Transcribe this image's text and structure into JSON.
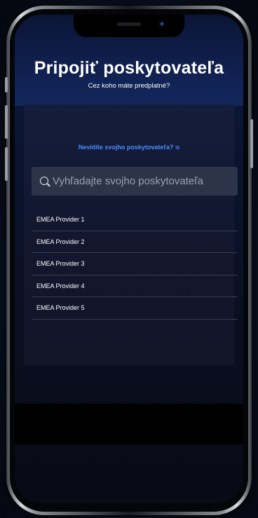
{
  "header": {
    "title": "Pripojiť poskytovateľa",
    "subtitle": "Cez koho máte predplatné?"
  },
  "help_link": {
    "label": "Nevidíte svojho poskytovateľa?",
    "icon": "external-link-icon"
  },
  "search": {
    "placeholder": "Vyhľadajte svojho poskytovateľa",
    "value": "",
    "icon": "search-icon"
  },
  "providers": [
    {
      "label": "EMEA Provider 1"
    },
    {
      "label": "EMEA Provider 2"
    },
    {
      "label": "EMEA Provider 3"
    },
    {
      "label": "EMEA Provider 4"
    },
    {
      "label": "EMEA Provider 5"
    }
  ],
  "colors": {
    "accent_link": "#4c8dff",
    "search_bg": "#2d3449",
    "background": "#0a1430"
  }
}
